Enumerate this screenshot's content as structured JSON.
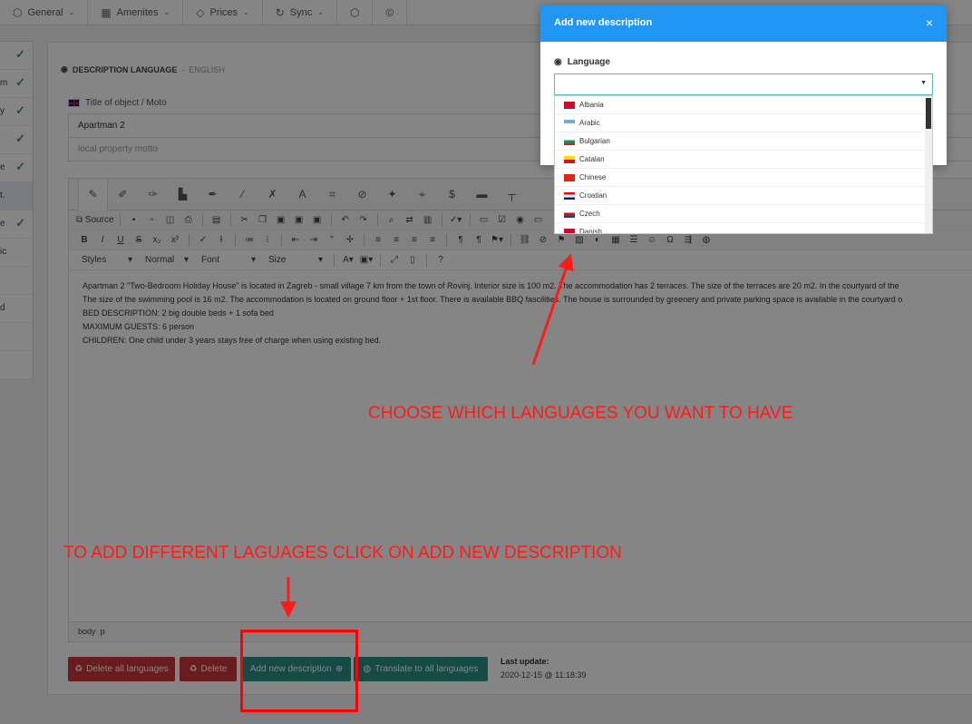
{
  "topnav": [
    {
      "label": "General",
      "icon": "cube-icon"
    },
    {
      "label": "Amenites",
      "icon": "grid-icon"
    },
    {
      "label": "Prices",
      "icon": "tag-icon"
    },
    {
      "label": "Sync",
      "icon": "sync-icon"
    }
  ],
  "sidebar": {
    "fragments": [
      "",
      "m",
      "y",
      "",
      "e",
      "t.",
      "e",
      "ic",
      "",
      "d",
      "",
      ""
    ]
  },
  "main": {
    "section_label": "DESCRIPTION LANGUAGE",
    "section_sep": "-",
    "section_lang": "ENGLISH",
    "title_label": "Title of object / Moto",
    "title_value": "Apartman 2",
    "motto_placeholder": "local property motto"
  },
  "editor": {
    "source_label": "Source",
    "styles_label": "Styles",
    "format_label": "Normal",
    "font_label": "Font",
    "size_label": "Size",
    "content_lines": [
      "Apartman 2  \"Two-Bedroom Holiday House\" is located in Zagreb  - small village 7 km from the town of Rovinj. Interior size is 100 m2. The accommodation has 2 terraces. The size of the terraces are 20 m2. In the courtyard of the",
      "The size of the swimming pool is 16 m2. The accommodation is located on ground floor + 1st floor. There is available BBQ fascilities. The house is surrounded by greenery and private parking space is available in the courtyard o",
      "BED DESCRIPTION: 2  big double beds + 1 sofa bed",
      "MAXIMUM GUESTS: 6 person",
      "CHILDREN: One child under 3 years stays free of charge when using existing bed."
    ],
    "path_body": "body",
    "path_p": "p"
  },
  "buttons": {
    "delete_all": "Delete all languages",
    "delete": "Delete",
    "add_new": "Add new description",
    "translate_all": "Translate to all languages"
  },
  "last_update": {
    "label": "Last update:",
    "value": "2020-12-15 @ 11:18:39"
  },
  "modal": {
    "title": "Add new description",
    "close": "×",
    "language_label": "Language",
    "options": [
      {
        "label": "Albania",
        "colors": [
          "#c8102e",
          "#c8102e"
        ]
      },
      {
        "label": "Arabic",
        "colors": [
          "#74acdf",
          "#ffffff"
        ]
      },
      {
        "label": "Bulgarian",
        "colors": [
          "#ffffff",
          "#00966e",
          "#d62612"
        ]
      },
      {
        "label": "Catalan",
        "colors": [
          "#fcdd09",
          "#da121a"
        ]
      },
      {
        "label": "Chinese",
        "colors": [
          "#de2910",
          "#de2910"
        ]
      },
      {
        "label": "Croatian",
        "colors": [
          "#ff0000",
          "#ffffff",
          "#171796"
        ]
      },
      {
        "label": "Czech",
        "colors": [
          "#ffffff",
          "#d7141a",
          "#11457e"
        ]
      },
      {
        "label": "Danish",
        "colors": [
          "#c8102e",
          "#c8102e"
        ]
      }
    ]
  },
  "annotations": {
    "choose": "CHOOSE WHICH LANGUAGES YOU WANT TO HAVE",
    "add": "TO ADD DIFFERENT LAGUAGES CLICK ON ADD NEW DESCRIPTION"
  }
}
